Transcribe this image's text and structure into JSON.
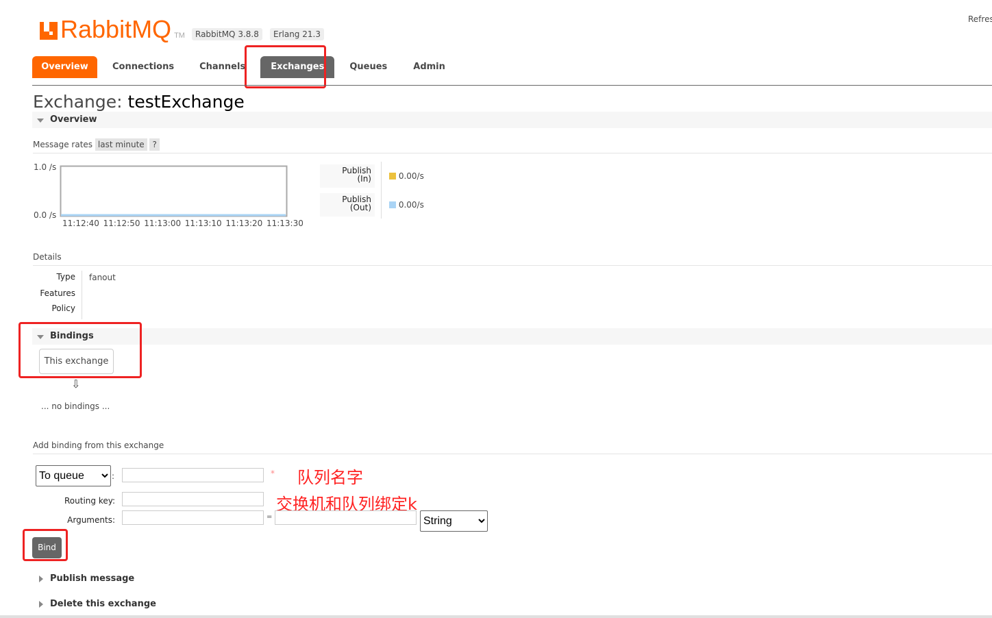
{
  "header": {
    "logo_text": "RabbitMQ",
    "logo_tm": "TM",
    "version": "RabbitMQ 3.8.8",
    "erlang": "Erlang 21.3",
    "refresh": "Refres"
  },
  "nav": {
    "tabs": [
      {
        "label": "Overview"
      },
      {
        "label": "Connections"
      },
      {
        "label": "Channels"
      },
      {
        "label": "Exchanges"
      },
      {
        "label": "Queues"
      },
      {
        "label": "Admin"
      }
    ],
    "active": "Exchanges"
  },
  "page": {
    "title_prefix": "Exchange:",
    "title_name": "testExchange"
  },
  "overview": {
    "heading": "Overview",
    "rates_label": "Message rates",
    "rates_range": "last minute",
    "help": "?",
    "legend": [
      {
        "label_line1": "Publish",
        "label_line2": "(In)",
        "value": "0.00/s",
        "color": "#ecc13d"
      },
      {
        "label_line1": "Publish",
        "label_line2": "(Out)",
        "value": "0.00/s",
        "color": "#aad4f5"
      }
    ]
  },
  "chart_data": {
    "type": "line",
    "x": [
      "11:12:40",
      "11:12:50",
      "11:13:00",
      "11:13:10",
      "11:13:20",
      "11:13:30"
    ],
    "y_ticks": [
      "1.0 /s",
      "0.0 /s"
    ],
    "ylim": [
      0,
      1
    ],
    "series": [
      {
        "name": "Publish (In)",
        "values": [
          0,
          0,
          0,
          0,
          0,
          0
        ]
      },
      {
        "name": "Publish (Out)",
        "values": [
          0,
          0,
          0,
          0,
          0,
          0
        ]
      }
    ]
  },
  "details": {
    "heading": "Details",
    "rows": [
      {
        "label": "Type",
        "value": "fanout"
      },
      {
        "label": "Features",
        "value": ""
      },
      {
        "label": "Policy",
        "value": ""
      }
    ]
  },
  "bindings": {
    "heading": "Bindings",
    "this_exchange": "This exchange",
    "arrow": "⇩",
    "empty": "... no bindings ..."
  },
  "add_binding": {
    "heading": "Add binding from this exchange",
    "destination": "To queue",
    "colon": ":",
    "required": "*",
    "routing_key_label": "Routing key:",
    "arguments_label": "Arguments:",
    "equals": "=",
    "arg_type": "String",
    "bind": "Bind",
    "annotations": [
      "队列名字",
      "交换机和队列绑定k"
    ]
  },
  "publish": {
    "heading": "Publish message"
  },
  "delete": {
    "heading": "Delete this exchange"
  }
}
